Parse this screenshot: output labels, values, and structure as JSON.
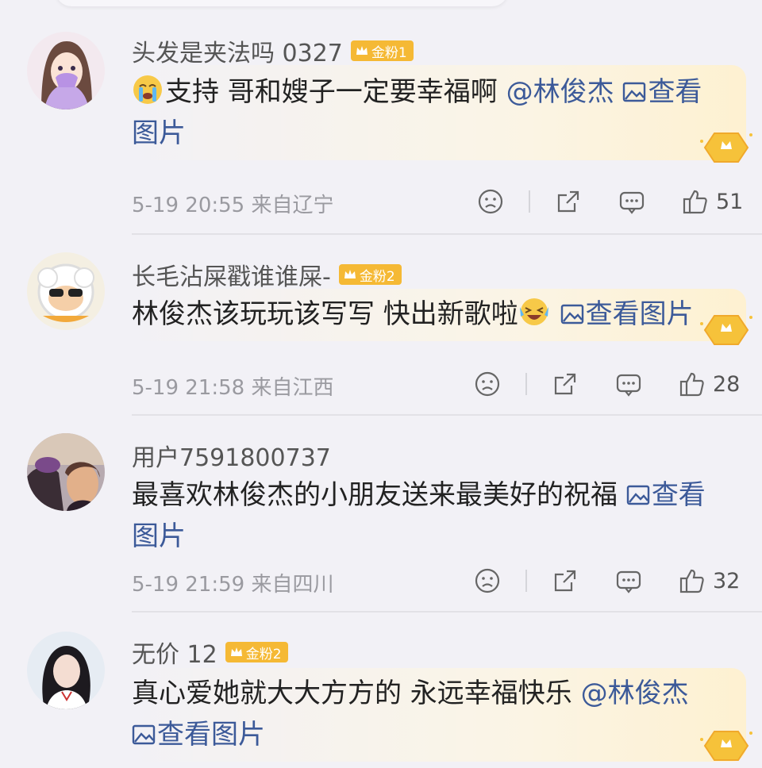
{
  "comments": [
    {
      "username": "头发是夹法吗 0327",
      "badge": "金粉1",
      "lead_emoji": "crying-face",
      "text": "支持 哥和嫂子一定要幸福啊",
      "mention": "@林俊杰",
      "view_label": "查看",
      "view_label_tail": "图片",
      "date": "5-19 20:55",
      "location": "来自辽宁",
      "likes": "51"
    },
    {
      "username": "长毛沾屎戳谁谁屎-",
      "badge": "金粉2",
      "text": "林俊杰该玩玩该写写 快出新歌啦",
      "trail_emoji": "laughing-tears-face",
      "view_label": "查看图片",
      "date": "5-19 21:58",
      "location": "来自江西",
      "likes": "28"
    },
    {
      "username": "用户7591800737",
      "text": "最喜欢林俊杰的小朋友送来最美好的祝福",
      "view_label": "查看",
      "view_label_tail": "图片",
      "date": "5-19 21:59",
      "location": "来自四川",
      "likes": "32"
    },
    {
      "username": "无价 12",
      "badge": "金粉2",
      "text": "真心爱她就大大方方的 永远幸福快乐",
      "mention": "@林俊杰",
      "view_label": "查看图片"
    }
  ],
  "colors": {
    "background": "#f2f1f6",
    "link": "#3c5a99",
    "badge": "#f5b935",
    "meta": "#9a9aa0"
  }
}
